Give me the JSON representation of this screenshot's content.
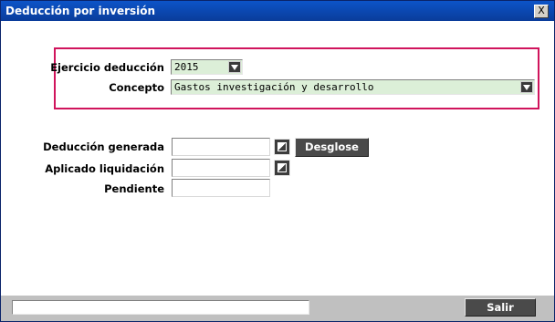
{
  "window": {
    "title": "Deducción por inversión",
    "close_label": "X"
  },
  "form": {
    "ejercicio_label": "Ejercicio deducción",
    "ejercicio_value": "2015",
    "concepto_label": "Concepto",
    "concepto_value": "Gastos investigación y desarrollo",
    "deduccion_generada_label": "Deducción generada",
    "deduccion_generada_value": "",
    "aplicado_liquidacion_label": "Aplicado liquidación",
    "aplicado_liquidacion_value": "",
    "pendiente_label": "Pendiente",
    "pendiente_value": ""
  },
  "buttons": {
    "desglose": "Desglose",
    "salir": "Salir"
  },
  "status": {
    "text": ""
  },
  "colors": {
    "highlight_border": "#d0145c",
    "combo_bg": "#dcefd8",
    "titlebar": "#0a3c9a"
  }
}
